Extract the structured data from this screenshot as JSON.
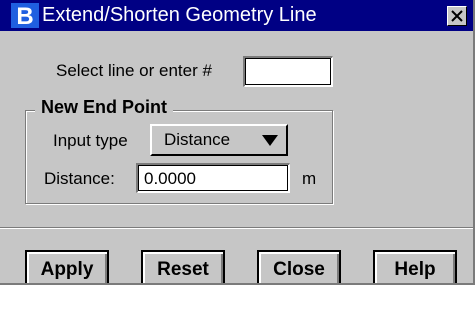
{
  "window": {
    "title": "Extend/Shorten Geometry Line",
    "app_icon": "geopak-b-icon",
    "close_icon": "close-x-icon"
  },
  "select": {
    "label": "Select line or enter #",
    "value": ""
  },
  "group": {
    "title": "New End Point",
    "input_type_label": "Input type",
    "input_type_value": "Distance",
    "distance_label": "Distance:",
    "distance_value": "0.0000",
    "distance_unit": "m"
  },
  "buttons": {
    "apply": "Apply",
    "reset": "Reset",
    "close": "Close",
    "help": "Help"
  },
  "colors": {
    "title_bar": "#000084",
    "dialog_face": "#c6c6c6",
    "icon_blue": "#1f5fe0"
  }
}
